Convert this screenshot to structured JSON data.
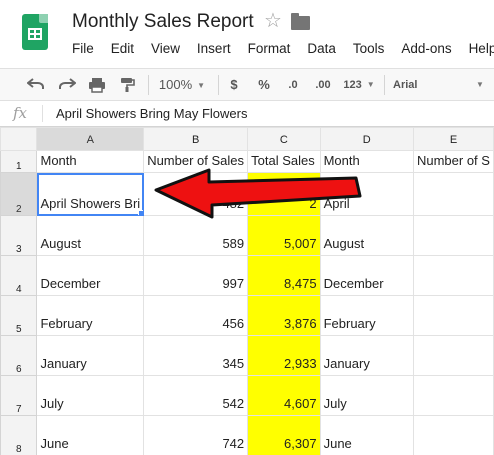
{
  "header": {
    "title": "Monthly Sales Report",
    "menu": [
      "File",
      "Edit",
      "View",
      "Insert",
      "Format",
      "Data",
      "Tools",
      "Add-ons",
      "Help"
    ]
  },
  "toolbar": {
    "zoom": "100%",
    "currency": "$",
    "percent": "%",
    "decrease_decimal": ".0",
    "increase_decimal": ".00",
    "more_formats": "123",
    "font": "Arial"
  },
  "formula_bar": {
    "fx": "fx",
    "value": "April Showers Bring May Flowers"
  },
  "grid": {
    "columns": [
      "A",
      "B",
      "C",
      "D",
      "E"
    ],
    "rows": [
      {
        "num": "1",
        "cells": [
          "Month",
          "Number of Sales",
          "Total Sales",
          "Month",
          "Number of S"
        ]
      },
      {
        "num": "2",
        "cells": [
          "April Showers Bri",
          "482",
          "2",
          "April",
          ""
        ]
      },
      {
        "num": "3",
        "cells": [
          "August",
          "589",
          "5,007",
          "August",
          ""
        ]
      },
      {
        "num": "4",
        "cells": [
          "December",
          "997",
          "8,475",
          "December",
          ""
        ]
      },
      {
        "num": "5",
        "cells": [
          "February",
          "456",
          "3,876",
          "February",
          ""
        ]
      },
      {
        "num": "6",
        "cells": [
          "January",
          "345",
          "2,933",
          "January",
          ""
        ]
      },
      {
        "num": "7",
        "cells": [
          "July",
          "542",
          "4,607",
          "July",
          ""
        ]
      },
      {
        "num": "8",
        "cells": [
          "June",
          "742",
          "6,307",
          "June",
          ""
        ]
      }
    ]
  },
  "colors": {
    "highlight": "#ffff00",
    "selection": "#4285f4",
    "arrow": "#ee1111",
    "brand": "#1fa463"
  }
}
